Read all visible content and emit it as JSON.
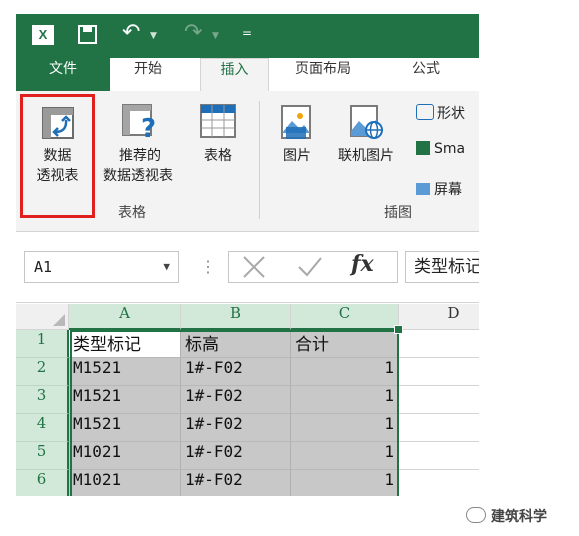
{
  "quick_access": {
    "app_icon": "X",
    "customize_glyph": "="
  },
  "tabs": [
    {
      "label": "文件"
    },
    {
      "label": "开始"
    },
    {
      "label": "插入"
    },
    {
      "label": "页面布局"
    },
    {
      "label": "公式"
    }
  ],
  "ribbon": {
    "pivot_table": {
      "line1": "数据",
      "line2": "透视表"
    },
    "recommended_pivot": {
      "line1": "推荐的",
      "line2": "数据透视表"
    },
    "table": {
      "label": "表格"
    },
    "tables_group_label": "表格",
    "pictures": {
      "label": "图片"
    },
    "online_pictures": {
      "label": "联机图片"
    },
    "illustrations_group_label": "插图",
    "shapes": {
      "label": "形状"
    },
    "smartart": {
      "label": "Sma"
    },
    "screenshot": {
      "label": "屏幕"
    }
  },
  "formula_bar": {
    "name_box": "A1",
    "fx_symbol": "fx",
    "content": "类型标记"
  },
  "grid": {
    "columns": [
      "A",
      "B",
      "C",
      "D"
    ],
    "rows": [
      {
        "num": "1",
        "a": "类型标记",
        "b": "标高",
        "c": "合计"
      },
      {
        "num": "2",
        "a": "M1521",
        "b": "1#-F02",
        "c": "1"
      },
      {
        "num": "3",
        "a": "M1521",
        "b": "1#-F02",
        "c": "1"
      },
      {
        "num": "4",
        "a": "M1521",
        "b": "1#-F02",
        "c": "1"
      },
      {
        "num": "5",
        "a": "M1021",
        "b": "1#-F02",
        "c": "1"
      },
      {
        "num": "6",
        "a": "M1021",
        "b": "1#-F02",
        "c": "1"
      }
    ]
  },
  "watermark": "建筑科学",
  "colors": {
    "excel_green": "#217346",
    "highlight_red": "#e0201f",
    "selection_fill": "#c8c8c8"
  }
}
